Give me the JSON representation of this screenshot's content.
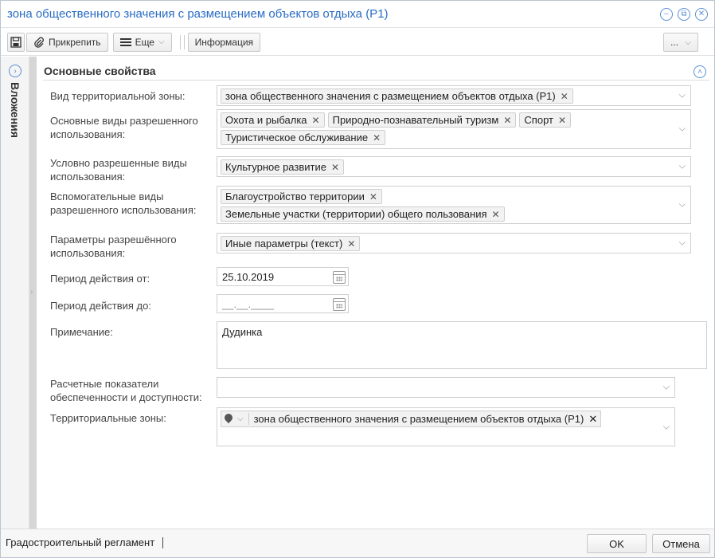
{
  "window": {
    "title": "зона общественного значения с размещением объектов отдыха (Р1)"
  },
  "toolbar": {
    "save_icon": "save-icon",
    "attach_label": "Прикрепить",
    "more_label": "Еще",
    "info_label": "Информация",
    "right_menu_label": "..."
  },
  "sidebar": {
    "label": "Вложения"
  },
  "section": {
    "title": "Основные свойства"
  },
  "fields": {
    "zone_type": {
      "label": "Вид территориальной зоны:",
      "tags": [
        "зона общественного значения с размещением объектов отдыха (Р1)"
      ]
    },
    "main_uses": {
      "label": "Основные виды разрешенного использования:",
      "tags": [
        "Охота и рыбалка",
        "Природно-познавательный туризм",
        "Спорт",
        "Туристическое обслуживание"
      ]
    },
    "conditional_uses": {
      "label": "Условно разрешенные виды использования:",
      "tags": [
        "Культурное развитие"
      ]
    },
    "auxiliary_uses": {
      "label": "Вспомогательные виды разрешенного использования:",
      "tags": [
        "Благоустройство территории",
        "Земельные участки (территории) общего пользования"
      ]
    },
    "use_params": {
      "label": "Параметры разрешённого использования:",
      "tags": [
        "Иные параметры (текст)"
      ]
    },
    "period_from": {
      "label": "Период действия от:",
      "value": "25.10.2019"
    },
    "period_to": {
      "label": "Период действия до:",
      "value": "__.__.____"
    },
    "note": {
      "label": "Примечание:",
      "value": "Дудинка"
    },
    "indicators": {
      "label": "Расчетные показатели обеспеченности и доступности:"
    },
    "territorial_zones": {
      "label": "Территориальные зоны:",
      "tags": [
        "зона общественного значения с размещением объектов отдыха (Р1)"
      ]
    }
  },
  "statusbar": {
    "left_label": "Градостроительный регламент",
    "ok_label": "OK",
    "cancel_label": "Отмена"
  }
}
